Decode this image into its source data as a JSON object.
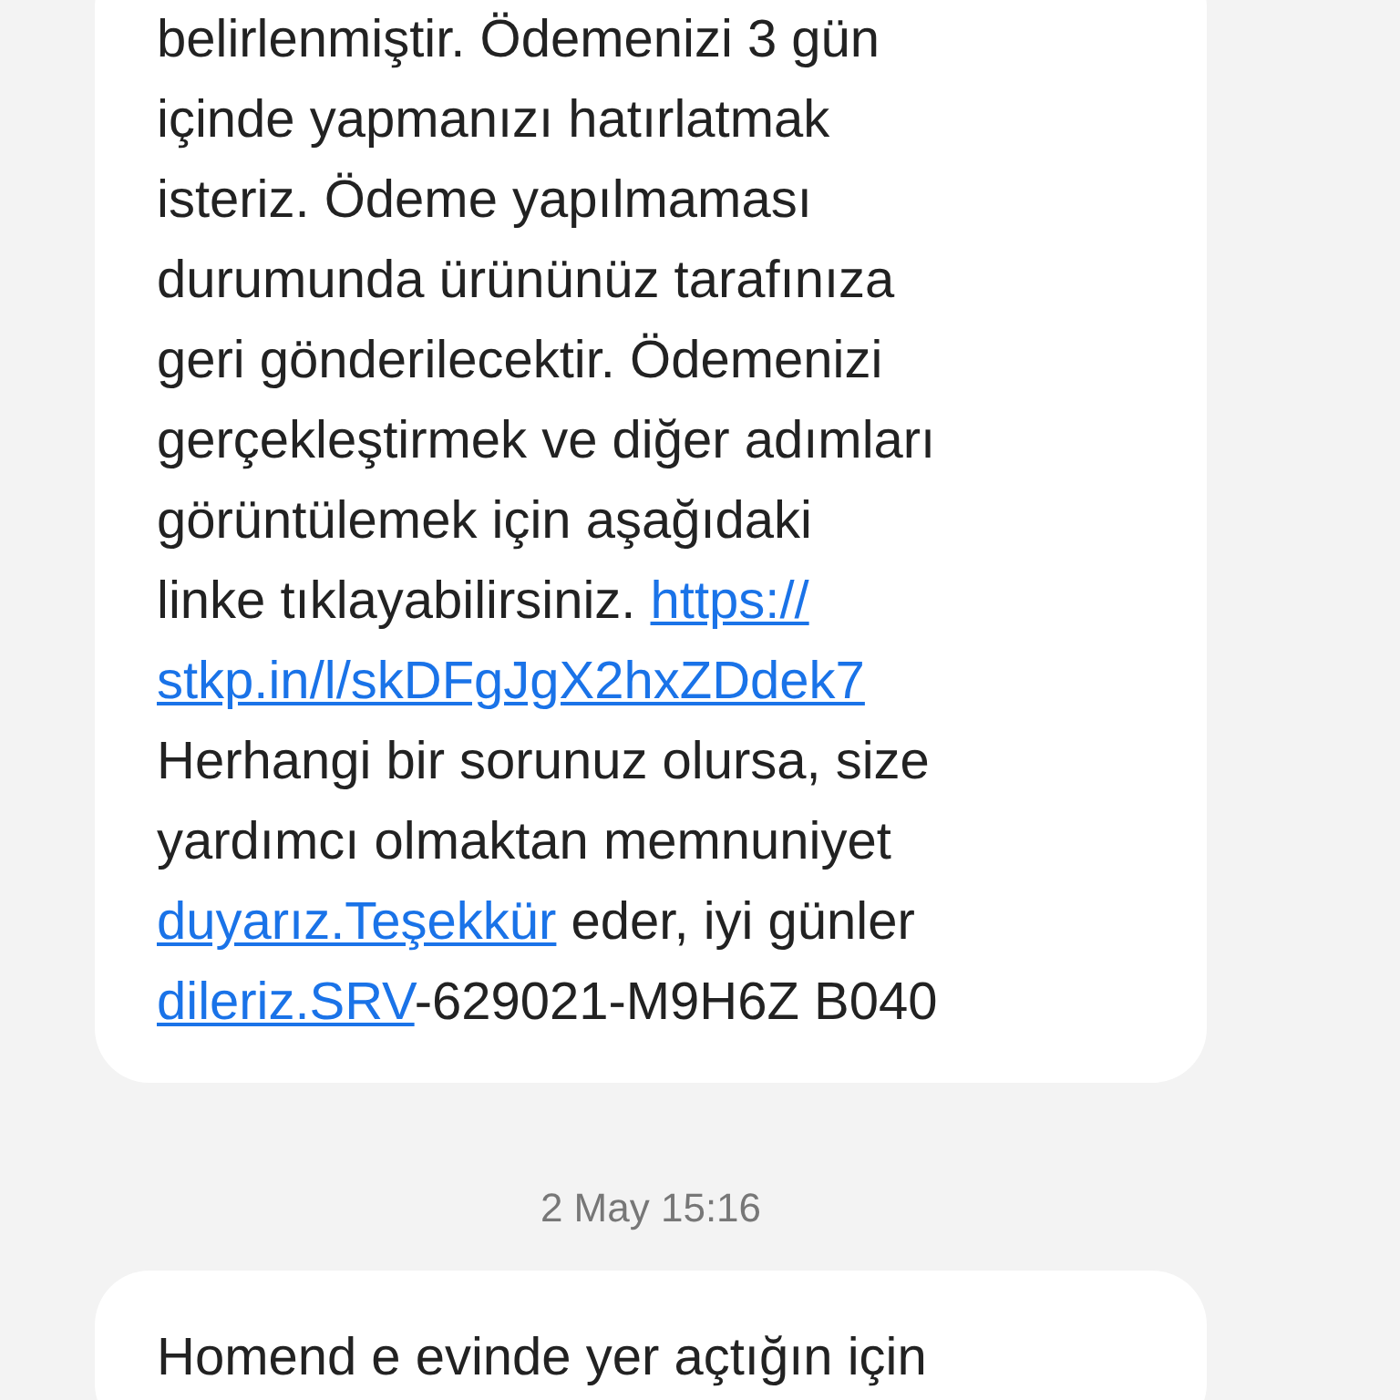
{
  "messages": [
    {
      "lines": [
        [
          {
            "text": "belirlenmiştir. Ödemenizi 3 gün",
            "link": false
          }
        ],
        [
          {
            "text": "içinde yapmanızı hatırlatmak",
            "link": false
          }
        ],
        [
          {
            "text": "isteriz. Ödeme yapılmaması",
            "link": false
          }
        ],
        [
          {
            "text": "durumunda ürününüz tarafınıza",
            "link": false
          }
        ],
        [
          {
            "text": "geri gönderilecektir. Ödemenizi",
            "link": false
          }
        ],
        [
          {
            "text": "gerçekleştirmek ve diğer adımları",
            "link": false
          }
        ],
        [
          {
            "text": "görüntülemek için aşağıdaki",
            "link": false
          }
        ],
        [
          {
            "text": "linke tıklayabilirsiniz. ",
            "link": false
          },
          {
            "text": "https://",
            "link": true
          }
        ],
        [
          {
            "text": "stkp.in/l/skDFgJgX2hxZDdek7",
            "link": true
          }
        ],
        [
          {
            "text": "Herhangi bir sorunuz olursa, size",
            "link": false
          }
        ],
        [
          {
            "text": "yardımcı olmaktan memnuniyet",
            "link": false
          }
        ],
        [
          {
            "text": "duyarız.Teşekkür",
            "link": true
          },
          {
            "text": " eder, iyi günler",
            "link": false
          }
        ],
        [
          {
            "text": "dileriz.SRV",
            "link": true
          },
          {
            "text": "-629021-M9H6Z B040",
            "link": false
          }
        ]
      ]
    },
    {
      "date": "2 May 15:16",
      "lines": [
        [
          {
            "text": "Homend e evinde yer açtığın için",
            "link": false
          }
        ]
      ]
    }
  ]
}
